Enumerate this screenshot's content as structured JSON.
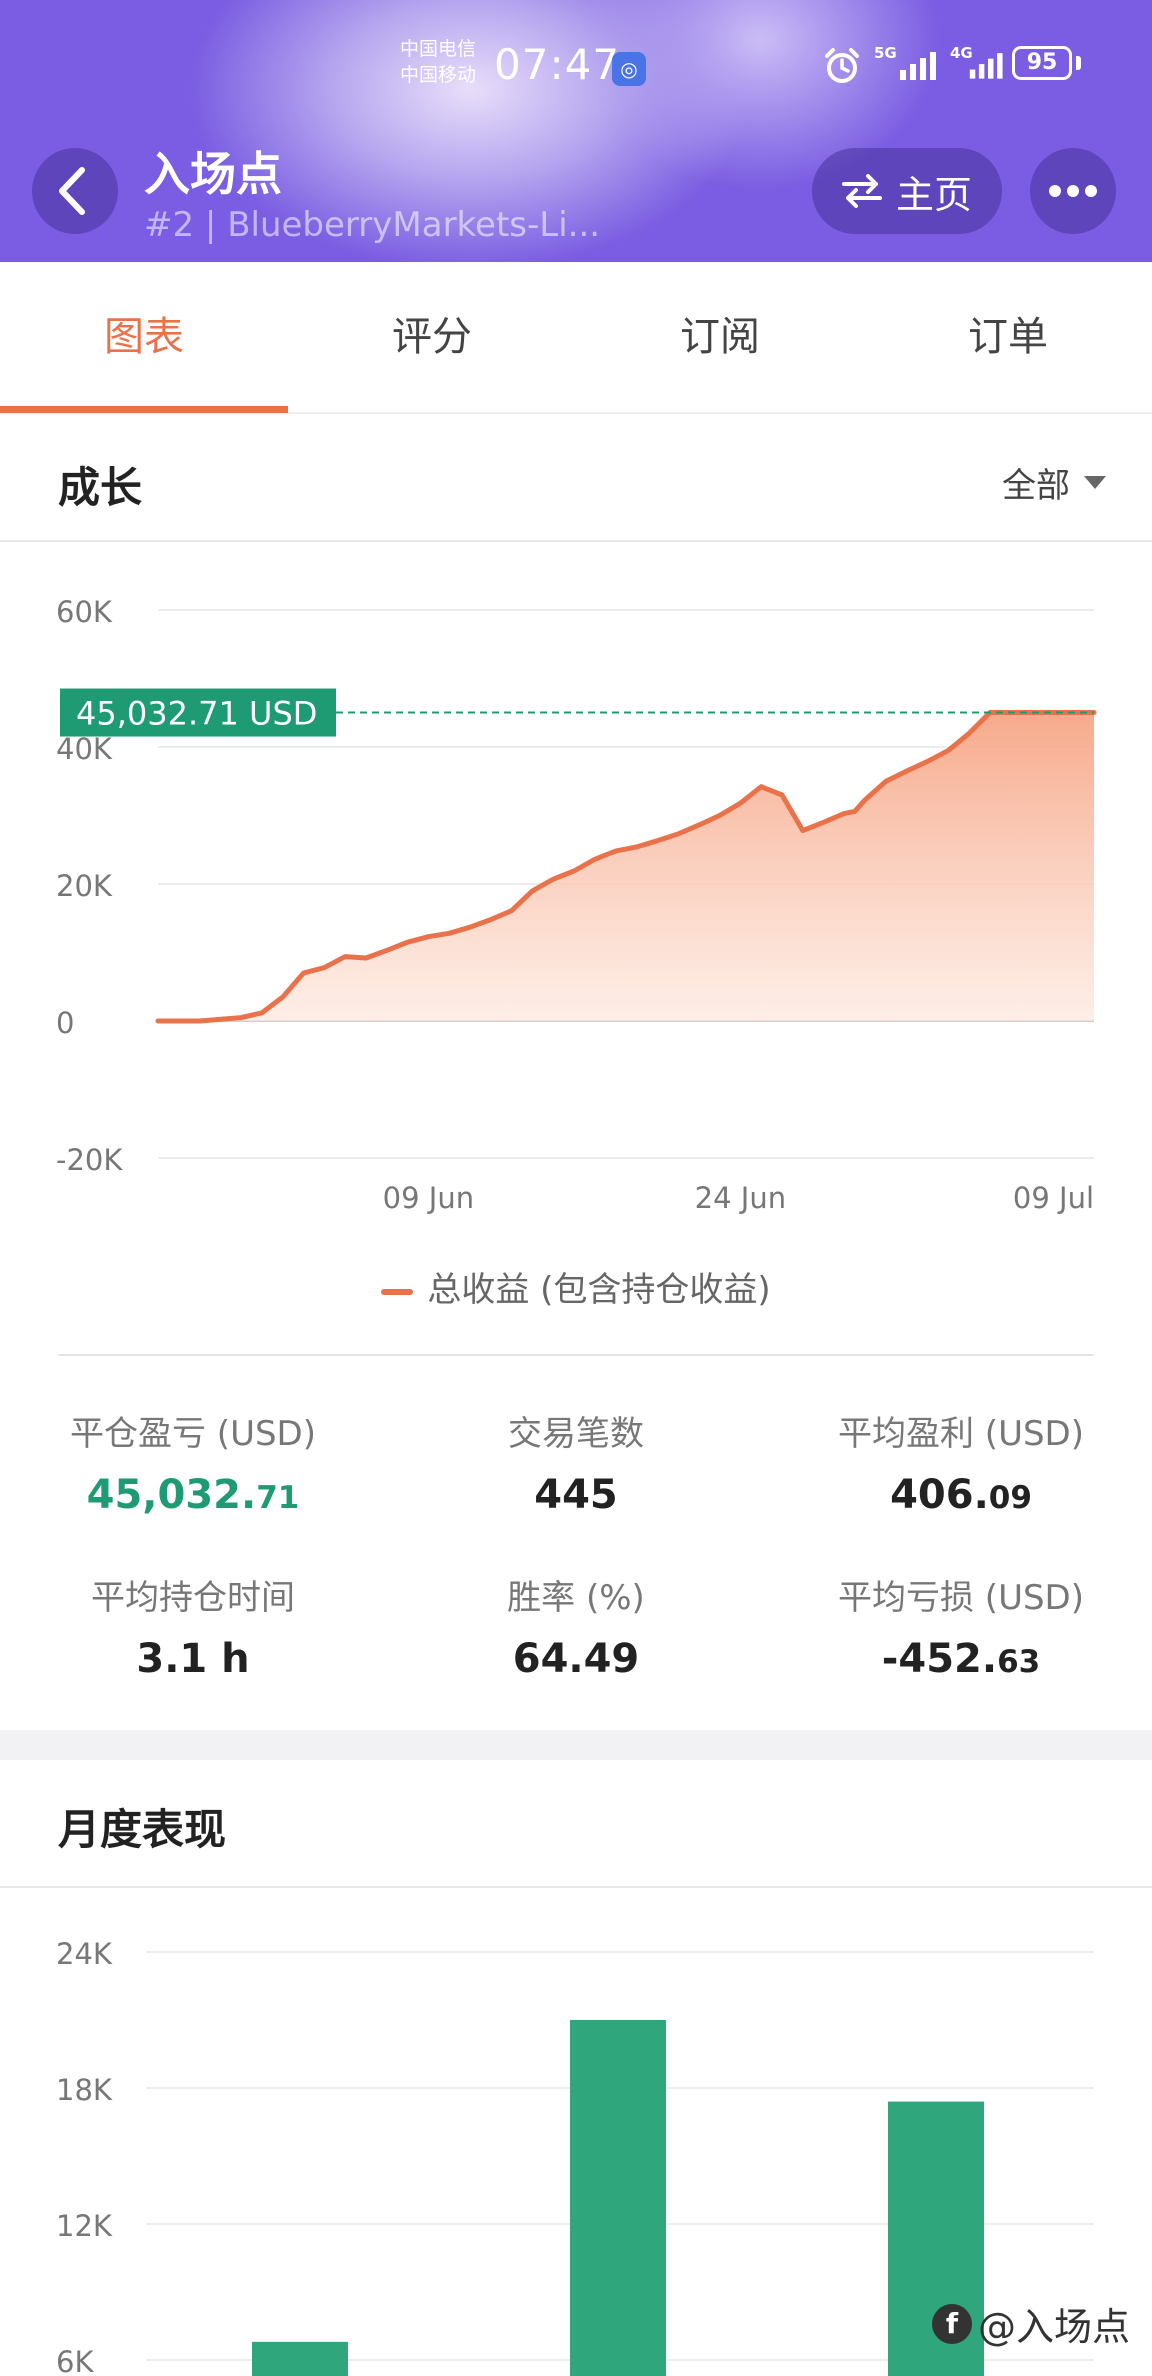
{
  "status_bar": {
    "carrier_1": "中国电信",
    "carrier_2": "中国移动",
    "time": "07:47",
    "network_1": "5G",
    "network_2": "4G",
    "battery": "95"
  },
  "header": {
    "title": "入场点",
    "subtitle": "#2 | BlueberryMarkets-Li...",
    "home_label": "主页",
    "icons": [
      "chevron-left-icon",
      "swap-icon",
      "more-icon"
    ]
  },
  "tabs": [
    {
      "label": "图表",
      "active": true
    },
    {
      "label": "评分",
      "active": false
    },
    {
      "label": "订阅",
      "active": false
    },
    {
      "label": "订单",
      "active": false
    }
  ],
  "growth": {
    "title": "成长",
    "filter": "全部",
    "legend": "总收益 (包含持仓收益)"
  },
  "stats": [
    {
      "label": "平仓盈亏 (USD)",
      "int": "45,032.",
      "frac": "71",
      "positive": true
    },
    {
      "label": "交易笔数",
      "int": "445",
      "frac": "",
      "positive": false
    },
    {
      "label": "平均盈利 (USD)",
      "int": "406.",
      "frac": "09",
      "positive": false
    },
    {
      "label": "平均持仓时间",
      "int": "3.1 h",
      "frac": "",
      "positive": false
    },
    {
      "label": "胜率 (%)",
      "int": "64.49",
      "frac": "",
      "positive": false
    },
    {
      "label": "平均亏损 (USD)",
      "int": "-452.",
      "frac": "63",
      "positive": false
    }
  ],
  "monthly": {
    "title": "月度表现"
  },
  "watermark": "@入场点",
  "colors": {
    "header_purple": "#7a5de2",
    "accent_orange": "#e9724a",
    "positive_green": "#1f9b74",
    "bar_green": "#2fa67c"
  },
  "chart_data": [
    {
      "type": "area",
      "name": "growth",
      "ylim": [
        -20000,
        60000
      ],
      "yticks": [
        -20000,
        0,
        20000,
        40000,
        60000
      ],
      "ytick_labels": [
        "-20K",
        "0",
        "20K",
        "40K",
        "60K"
      ],
      "x_tick_labels": [
        "09 Jun",
        "24 Jun",
        "09 Jul"
      ],
      "x_tick_days": [
        13,
        28,
        43
      ],
      "current_value_label": "45,032.71 USD",
      "current_value": 45032.71,
      "grid": true,
      "legend_position": "bottom",
      "series": [
        {
          "name": "总收益 (包含持仓收益)",
          "x": [
            0,
            2,
            4,
            5,
            6,
            7,
            8,
            9,
            10,
            11,
            12,
            13,
            14,
            15,
            16,
            17,
            18,
            19,
            20,
            21,
            22,
            23,
            24,
            25,
            26,
            27,
            28,
            29,
            30,
            31,
            32,
            33,
            33.5,
            34,
            35,
            36,
            37,
            38,
            39,
            40,
            41,
            42,
            43,
            44,
            45
          ],
          "y": [
            0,
            0,
            500,
            1200,
            3500,
            7000,
            7800,
            9400,
            9200,
            10300,
            11500,
            12300,
            12800,
            13700,
            14800,
            16100,
            19000,
            20700,
            21900,
            23600,
            24800,
            25400,
            26300,
            27300,
            28600,
            30000,
            31800,
            34200,
            33000,
            27800,
            29000,
            30300,
            30600,
            32300,
            35000,
            36500,
            37900,
            39500,
            42000,
            45032,
            45032,
            45032,
            45032,
            45032,
            45032
          ]
        }
      ]
    },
    {
      "type": "bar",
      "name": "monthly",
      "ytick_labels": [
        "6K",
        "12K",
        "18K",
        "24K"
      ],
      "yticks": [
        6000,
        12000,
        18000,
        24000
      ],
      "ylim": [
        0,
        24000
      ],
      "grid": true,
      "values": [
        6800,
        21000,
        17400
      ]
    }
  ]
}
